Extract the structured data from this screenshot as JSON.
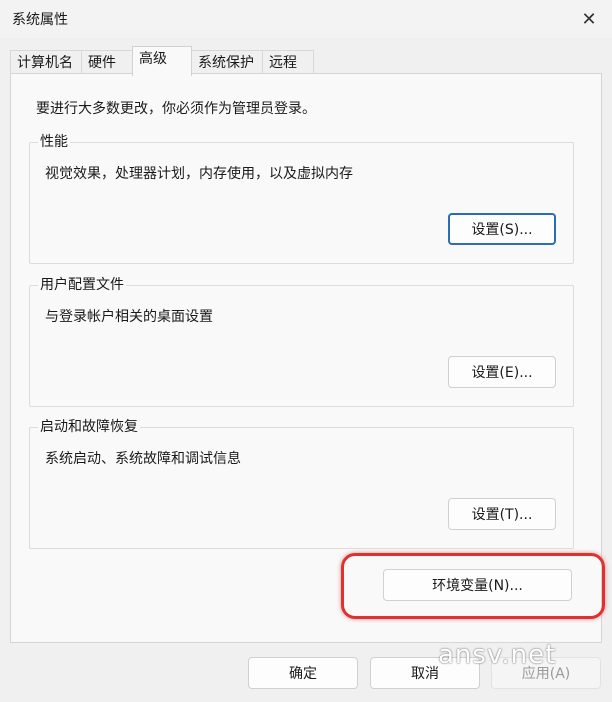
{
  "window": {
    "title": "系统属性",
    "close_glyph": "✕"
  },
  "tabs": [
    {
      "label": "计算机名",
      "active": false
    },
    {
      "label": "硬件",
      "active": false
    },
    {
      "label": "高级",
      "active": true
    },
    {
      "label": "系统保护",
      "active": false
    },
    {
      "label": "远程",
      "active": false
    }
  ],
  "advanced": {
    "admin_note": "要进行大多数更改，你必须作为管理员登录。",
    "performance": {
      "legend": "性能",
      "description": "视觉效果，处理器计划，内存使用，以及虚拟内存",
      "button": "设置(S)..."
    },
    "user_profiles": {
      "legend": "用户配置文件",
      "description": "与登录帐户相关的桌面设置",
      "button": "设置(E)..."
    },
    "startup_recovery": {
      "legend": "启动和故障恢复",
      "description": "系统启动、系统故障和调试信息",
      "button": "设置(T)..."
    },
    "env_button": "环境变量(N)..."
  },
  "footer": {
    "ok": "确定",
    "cancel": "取消",
    "apply": "应用(A)"
  },
  "annotation": {
    "highlight_color": "#e03030"
  },
  "watermark": "ansv.net",
  "colors": {
    "default_button_border": "#2b6cb8",
    "panel_bg": "#f9f9f9",
    "window_bg": "#f0f0f0"
  }
}
